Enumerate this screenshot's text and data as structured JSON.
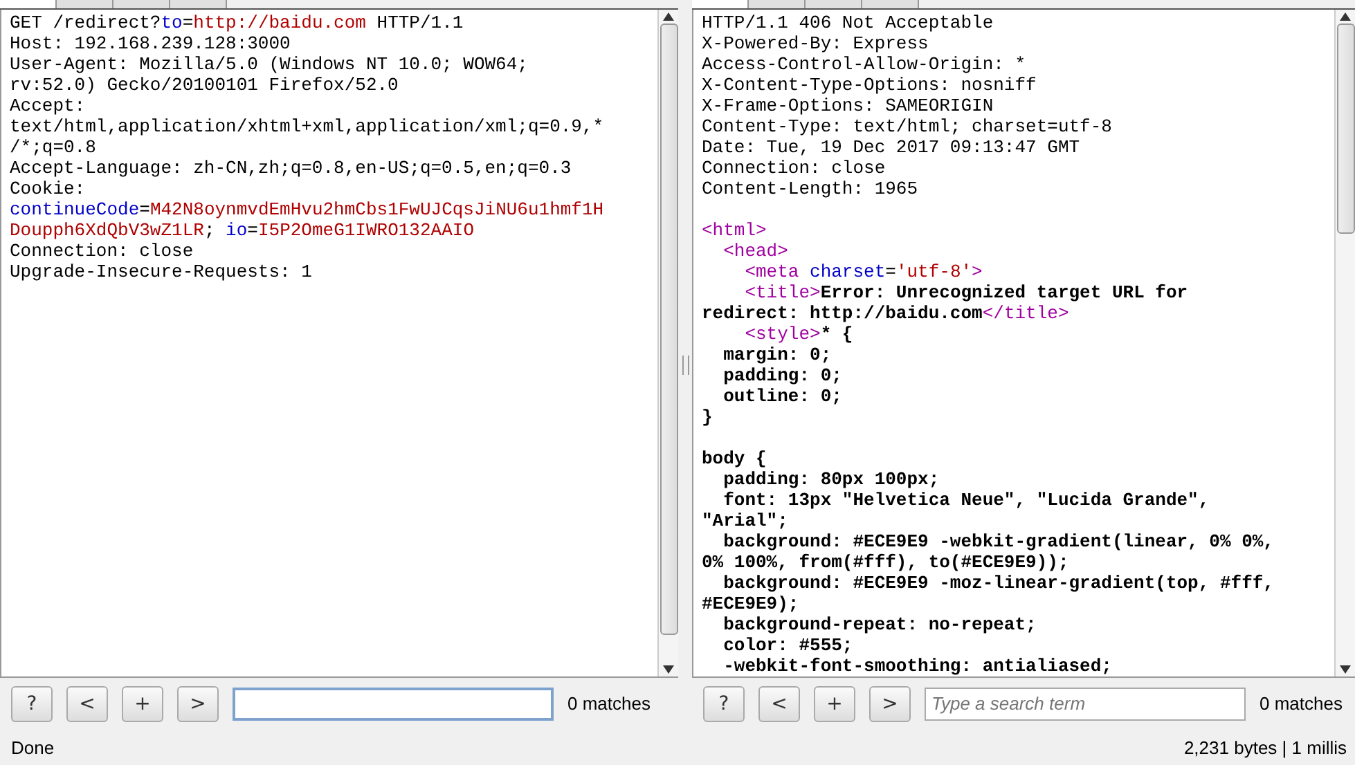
{
  "request_pane": {
    "lines": [
      {
        "kind": "text",
        "spans": [
          {
            "text": "GET /redirect?",
            "kind": "plain"
          },
          {
            "text": "to",
            "kind": "name"
          },
          {
            "text": "=",
            "kind": "plain"
          },
          {
            "text": "http://baidu.com",
            "kind": "value"
          },
          {
            "text": " HTTP/1.1",
            "kind": "plain"
          }
        ]
      },
      {
        "kind": "text",
        "spans": [
          {
            "text": "Host: 192.168.239.128:3000",
            "kind": "plain"
          }
        ]
      },
      {
        "kind": "text",
        "spans": [
          {
            "text": "User-Agent: Mozilla/5.0 (Windows NT 10.0; WOW64;",
            "kind": "plain"
          }
        ]
      },
      {
        "kind": "text",
        "spans": [
          {
            "text": "rv:52.0) Gecko/20100101 Firefox/52.0",
            "kind": "plain"
          }
        ]
      },
      {
        "kind": "text",
        "spans": [
          {
            "text": "Accept:",
            "kind": "plain"
          }
        ]
      },
      {
        "kind": "text",
        "spans": [
          {
            "text": "text/html,application/xhtml+xml,application/xml;q=0.9,*",
            "kind": "plain"
          }
        ]
      },
      {
        "kind": "text",
        "spans": [
          {
            "text": "/*;q=0.8",
            "kind": "plain"
          }
        ]
      },
      {
        "kind": "text",
        "spans": [
          {
            "text": "Accept-Language: zh-CN,zh;q=0.8,en-US;q=0.5,en;q=0.3",
            "kind": "plain"
          }
        ]
      },
      {
        "kind": "text",
        "spans": [
          {
            "text": "Cookie:",
            "kind": "plain"
          }
        ]
      },
      {
        "kind": "text",
        "spans": [
          {
            "text": "continueCode",
            "kind": "name"
          },
          {
            "text": "=",
            "kind": "plain"
          },
          {
            "text": "M42N8oynmvdEmHvu2hmCbs1FwUJCqsJiNU6u1hmf1H",
            "kind": "value"
          }
        ]
      },
      {
        "kind": "text",
        "spans": [
          {
            "text": "Doupph6XdQbV3wZ1LR",
            "kind": "value"
          },
          {
            "text": "; ",
            "kind": "plain"
          },
          {
            "text": "io",
            "kind": "name"
          },
          {
            "text": "=",
            "kind": "plain"
          },
          {
            "text": "I5P2OmeG1IWRO132AAIO",
            "kind": "value"
          }
        ]
      },
      {
        "kind": "text",
        "spans": [
          {
            "text": "Connection: close",
            "kind": "plain"
          }
        ]
      },
      {
        "kind": "text",
        "spans": [
          {
            "text": "Upgrade-Insecure-Requests: 1",
            "kind": "plain"
          }
        ]
      }
    ],
    "buttons": [
      "?",
      "<",
      "+",
      ">"
    ],
    "search": {
      "focused": true
    },
    "match_count": "0 matches"
  },
  "response_pane": {
    "lines": [
      {
        "kind": "text",
        "spans": [
          {
            "text": "HTTP/1.1 406 Not Acceptable",
            "kind": "plain"
          }
        ]
      },
      {
        "kind": "text",
        "spans": [
          {
            "text": "X-Powered-By: Express",
            "kind": "plain"
          }
        ]
      },
      {
        "kind": "text",
        "spans": [
          {
            "text": "Access-Control-Allow-Origin: *",
            "kind": "plain"
          }
        ]
      },
      {
        "kind": "text",
        "spans": [
          {
            "text": "X-Content-Type-Options: nosniff",
            "kind": "plain"
          }
        ]
      },
      {
        "kind": "text",
        "spans": [
          {
            "text": "X-Frame-Options: SAMEORIGIN",
            "kind": "plain"
          }
        ]
      },
      {
        "kind": "text",
        "spans": [
          {
            "text": "Content-Type: text/html; charset=utf-8",
            "kind": "plain"
          }
        ]
      },
      {
        "kind": "text",
        "spans": [
          {
            "text": "Date: Tue, 19 Dec 2017 09:13:47 GMT",
            "kind": "plain"
          }
        ]
      },
      {
        "kind": "text",
        "spans": [
          {
            "text": "Connection: close",
            "kind": "plain"
          }
        ]
      },
      {
        "kind": "text",
        "spans": [
          {
            "text": "Content-Length: 1965",
            "kind": "plain"
          }
        ]
      },
      {
        "kind": "blank"
      },
      {
        "kind": "text",
        "spans": [
          {
            "text": "<html>",
            "kind": "tag"
          }
        ]
      },
      {
        "kind": "text",
        "spans": [
          {
            "text": "  <head>",
            "kind": "tag"
          }
        ]
      },
      {
        "kind": "text",
        "spans": [
          {
            "text": "    <meta ",
            "kind": "tag"
          },
          {
            "text": "charset",
            "kind": "name"
          },
          {
            "text": "=",
            "kind": "plain"
          },
          {
            "text": "'utf-8'",
            "kind": "value"
          },
          {
            "text": ">",
            "kind": "tag"
          }
        ]
      },
      {
        "kind": "text",
        "spans": [
          {
            "text": "    <title>",
            "kind": "tag"
          },
          {
            "text": "Error: Unrecognized target URL for",
            "kind": "bold"
          }
        ]
      },
      {
        "kind": "text",
        "spans": [
          {
            "text": "redirect: http://baidu.com",
            "kind": "bold"
          },
          {
            "text": "</title>",
            "kind": "tag"
          }
        ]
      },
      {
        "kind": "text",
        "spans": [
          {
            "text": "    <style>",
            "kind": "tag"
          },
          {
            "text": "* {",
            "kind": "bold"
          }
        ]
      },
      {
        "kind": "text",
        "spans": [
          {
            "text": "  margin: 0;",
            "kind": "bold"
          }
        ]
      },
      {
        "kind": "text",
        "spans": [
          {
            "text": "  padding: 0;",
            "kind": "bold"
          }
        ]
      },
      {
        "kind": "text",
        "spans": [
          {
            "text": "  outline: 0;",
            "kind": "bold"
          }
        ]
      },
      {
        "kind": "text",
        "spans": [
          {
            "text": "}",
            "kind": "bold"
          }
        ]
      },
      {
        "kind": "blank"
      },
      {
        "kind": "text",
        "spans": [
          {
            "text": "body {",
            "kind": "bold"
          }
        ]
      },
      {
        "kind": "text",
        "spans": [
          {
            "text": "  padding: 80px 100px;",
            "kind": "bold"
          }
        ]
      },
      {
        "kind": "text",
        "spans": [
          {
            "text": "  font: 13px \"Helvetica Neue\", \"Lucida Grande\",",
            "kind": "bold"
          }
        ]
      },
      {
        "kind": "text",
        "spans": [
          {
            "text": "\"Arial\";",
            "kind": "bold"
          }
        ]
      },
      {
        "kind": "text",
        "spans": [
          {
            "text": "  background: #ECE9E9 -webkit-gradient(linear, 0% 0%,",
            "kind": "bold"
          }
        ]
      },
      {
        "kind": "text",
        "spans": [
          {
            "text": "0% 100%, from(#fff), to(#ECE9E9));",
            "kind": "bold"
          }
        ]
      },
      {
        "kind": "text",
        "spans": [
          {
            "text": "  background: #ECE9E9 -moz-linear-gradient(top, #fff,",
            "kind": "bold"
          }
        ]
      },
      {
        "kind": "text",
        "spans": [
          {
            "text": "#ECE9E9);",
            "kind": "bold"
          }
        ]
      },
      {
        "kind": "text",
        "spans": [
          {
            "text": "  background-repeat: no-repeat;",
            "kind": "bold"
          }
        ]
      },
      {
        "kind": "text",
        "spans": [
          {
            "text": "  color: #555;",
            "kind": "bold"
          }
        ]
      },
      {
        "kind": "text",
        "spans": [
          {
            "text": "  -webkit-font-smoothing: antialiased;",
            "kind": "bold"
          }
        ]
      }
    ],
    "buttons": [
      "?",
      "<",
      "+",
      ">"
    ],
    "search": {
      "placeholder": "Type a search term",
      "focused": false
    },
    "match_count": "0 matches"
  },
  "status_bar": {
    "message": "Done",
    "stats": "2,231 bytes | 1 millis"
  }
}
